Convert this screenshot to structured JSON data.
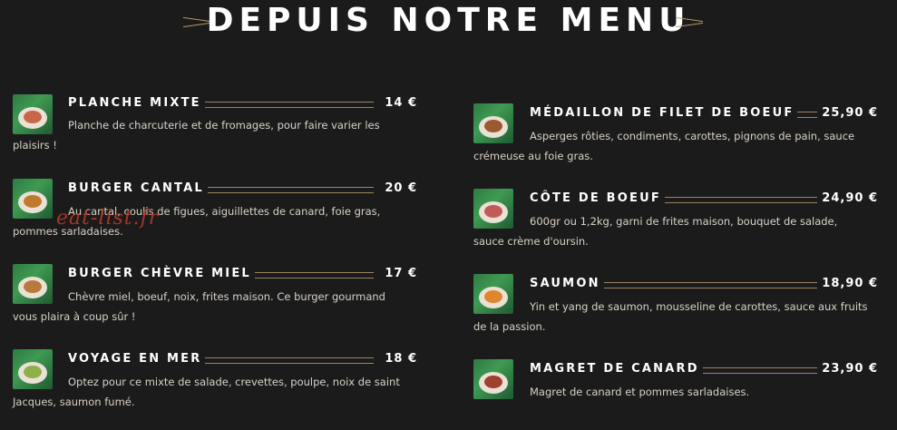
{
  "header": {
    "title": "DEPUIS NOTRE MENU"
  },
  "watermark": "eat-list.fr",
  "menu": {
    "left": [
      {
        "name": "PLANCHE MIXTE",
        "price": "14 €",
        "desc_first": "Planche de charcuterie et de fromages, pour faire varier les",
        "desc_rest": "plaisirs !",
        "food_color": "#c9664a"
      },
      {
        "name": "BURGER CANTAL",
        "price": "20 €",
        "desc_first": "Au cantal, coulis de figues, aiguillettes de canard, foie gras,",
        "desc_rest": "pommes sarladaises.",
        "food_color": "#c07a2e"
      },
      {
        "name": "BURGER CHÈVRE MIEL",
        "price": "17 €",
        "desc_first": "Chèvre miel, boeuf, noix, frites maison. Ce burger gourmand",
        "desc_rest": "vous plaira à coup sûr !",
        "food_color": "#b87a3a"
      },
      {
        "name": "VOYAGE EN MER",
        "price": "18 €",
        "desc_first": "Optez pour ce mixte de salade, crevettes, poulpe, noix de saint",
        "desc_rest": "Jacques, saumon fumé.",
        "food_color": "#8db04a"
      }
    ],
    "right": [
      {
        "name": "MÉDAILLON DE FILET DE BOEUF",
        "price": "25,90 €",
        "desc_first": "Asperges rôties, condiments, carottes, pignons de pain, sauce",
        "desc_rest": "crémeuse au foie gras.",
        "food_color": "#9a5a2e"
      },
      {
        "name": "CÔTE DE BOEUF",
        "price": "24,90 €",
        "desc_first": "600gr ou 1,2kg, garni de frites maison, bouquet de salade,",
        "desc_rest": "sauce crème d'oursin.",
        "food_color": "#c25a58"
      },
      {
        "name": "SAUMON",
        "price": "18,90 €",
        "desc_first": "Yin et yang de saumon, mousseline de carottes, sauce aux fruits",
        "desc_rest": "de la passion.",
        "food_color": "#e0862e"
      },
      {
        "name": "MAGRET DE CANARD",
        "price": "23,90 €",
        "desc_first": "Magret de canard et pommes sarladaises.",
        "desc_rest": "",
        "food_color": "#a0402e"
      }
    ]
  }
}
